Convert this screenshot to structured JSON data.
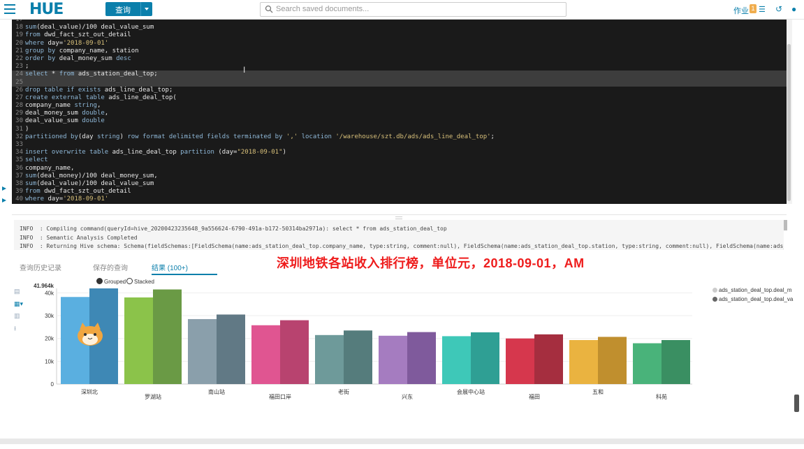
{
  "topbar": {
    "logo": "HUE",
    "query_button": "查询",
    "search_placeholder": "Search saved documents...",
    "jobs_label": "作业",
    "jobs_count": "1"
  },
  "editor": {
    "lines": [
      {
        "n": "18",
        "html": "<span class=\"kw\">sum</span>(deal_value)/100 deal_value_sum"
      },
      {
        "n": "19",
        "html": "<span class=\"kw\">from</span> dwd_fact_szt_out_detail"
      },
      {
        "n": "20",
        "html": "<span class=\"kw\">where</span> day=<span class=\"str\">'2018-09-01'</span>"
      },
      {
        "n": "21",
        "html": "<span class=\"kw\">group by</span> company_name, station"
      },
      {
        "n": "22",
        "html": "<span class=\"kw\">order by</span> deal_money_sum <span class=\"kw\">desc</span>"
      },
      {
        "n": "23",
        "html": ";"
      },
      {
        "n": "24",
        "html": "<span class=\"kw\">select</span> * <span class=\"kw\">from</span> ads_station_deal_top;",
        "sel": true
      },
      {
        "n": "25",
        "html": "",
        "sel": true
      },
      {
        "n": "26",
        "html": "<span class=\"kw\">drop table if exists</span> ads_line_deal_top;"
      },
      {
        "n": "27",
        "html": "<span class=\"kw\">create external table</span> ads_line_deal_top("
      },
      {
        "n": "28",
        "html": "company_name <span class=\"kw\">string</span>,"
      },
      {
        "n": "29",
        "html": "deal_money_sum <span class=\"kw\">double</span>,"
      },
      {
        "n": "30",
        "html": "deal_value_sum <span class=\"kw\">double</span>"
      },
      {
        "n": "31",
        "html": ")"
      },
      {
        "n": "32",
        "html": "<span class=\"kw\">partitioned by</span>(day <span class=\"kw\">string</span>) <span class=\"kw\">row format delimited fields terminated by</span> <span class=\"str\">','</span> <span class=\"kw\">location</span> <span class=\"str\">'/warehouse/szt.db/ads/ads_line_deal_top'</span>;"
      },
      {
        "n": "33",
        "html": ""
      },
      {
        "n": "34",
        "html": "<span class=\"kw\">insert overwrite table</span> ads_line_deal_top <span class=\"kw\">partition</span> (day=<span class=\"str\">\"2018-09-01\"</span>)"
      },
      {
        "n": "35",
        "html": "<span class=\"kw\">select</span>"
      },
      {
        "n": "36",
        "html": "company_name,"
      },
      {
        "n": "37",
        "html": "<span class=\"kw\">sum</span>(deal_money)/100 deal_money_sum,"
      },
      {
        "n": "38",
        "html": "<span class=\"kw\">sum</span>(deal_value)/100 deal_value_sum"
      },
      {
        "n": "39",
        "html": "<span class=\"kw\">from</span> dwd_fact_szt_out_detail"
      },
      {
        "n": "40",
        "html": "<span class=\"kw\">where</span> day=<span class=\"str\">'2018-09-01'</span>"
      }
    ]
  },
  "logs": [
    "INFO  : Compiling command(queryId=hive_20200423235648_9a556624-6790-491a-b172-50314ba2971a): select * from ads_station_deal_top",
    "INFO  : Semantic Analysis Completed",
    "INFO  : Returning Hive schema: Schema(fieldSchemas:[FieldSchema(name:ads_station_deal_top.company_name, type:string, comment:null), FieldSchema(name:ads_station_deal_top.station, type:string, comment:null), FieldSchema(name:ads_station_deal_"
  ],
  "tabs": [
    "查询历史记录",
    "保存的查询",
    "结果 (100+)"
  ],
  "overlay_text": "深圳地铁各站收入排行榜，单位元，2018-09-01，AM",
  "chart_toggle": {
    "grouped": "Grouped",
    "stacked": "Stacked"
  },
  "chart_data": {
    "type": "bar",
    "categories": [
      "深圳北",
      "罗湖站",
      "南山站",
      "福田口岸",
      "老街",
      "兴东",
      "会展中心站",
      "福田",
      "五和",
      "科苑"
    ],
    "series": [
      {
        "name": "ads_station_deal_top.deal_m",
        "color": "#5aafe0",
        "values": [
          38200,
          38000,
          28500,
          25800,
          21500,
          21200,
          21000,
          20000,
          19300,
          17900
        ]
      },
      {
        "name": "ads_station_deal_top.deal_va",
        "color": "#3e88b5",
        "values": [
          41964,
          41500,
          30500,
          28000,
          23500,
          22800,
          22700,
          21800,
          20700,
          19300
        ]
      }
    ],
    "bar_colors": [
      [
        "#5aafe0",
        "#3e88b5"
      ],
      [
        "#8bc34a",
        "#6a9a45"
      ],
      [
        "#8a9fab",
        "#617985"
      ],
      [
        "#e05591",
        "#b8436f"
      ],
      [
        "#6e9a9a",
        "#557c7c"
      ],
      [
        "#a57cc0",
        "#7f5a9c"
      ],
      [
        "#3ec8b8",
        "#2f9f94"
      ],
      [
        "#d6374d",
        "#a52e3f"
      ],
      [
        "#eab340",
        "#c08f2e"
      ],
      [
        "#49b37a",
        "#3a8f62"
      ]
    ],
    "ylim": [
      0,
      41964
    ],
    "yticks": [
      "0",
      "10k",
      "20k",
      "30k",
      "40k"
    ],
    "ymax_label": "41.964k"
  }
}
